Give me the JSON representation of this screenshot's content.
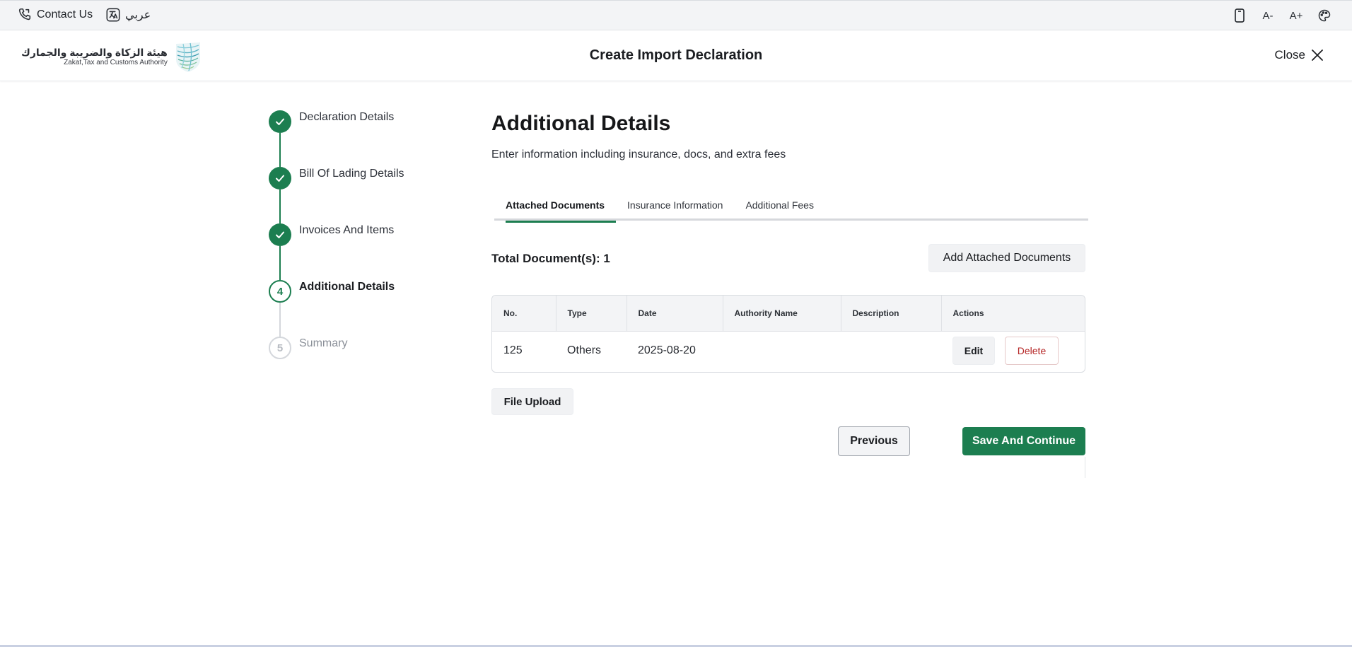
{
  "utility": {
    "contact_us": "Contact Us",
    "language": "عربي",
    "icons": [
      "phone-mobile-icon",
      "font-decrease-icon",
      "font-increase-icon",
      "palette-icon"
    ],
    "font_decrease": "A-",
    "font_increase": "A+"
  },
  "header": {
    "logo_arabic": "هيئة الزكاة والضريبة والجمارك",
    "logo_english": "Zakat,Tax and Customs Authority",
    "title": "Create Import Declaration",
    "close_label": "Close"
  },
  "stepper": {
    "steps": [
      {
        "number": "1",
        "label": "Declaration Details",
        "state": "done"
      },
      {
        "number": "2",
        "label": "Bill Of Lading Details",
        "state": "done"
      },
      {
        "number": "3",
        "label": "Invoices And Items",
        "state": "done"
      },
      {
        "number": "4",
        "label": "Additional Details",
        "state": "active"
      },
      {
        "number": "5",
        "label": "Summary",
        "state": "pending"
      }
    ]
  },
  "main": {
    "title": "Additional Details",
    "subtitle": "Enter information including insurance, docs, and extra fees",
    "tabs": [
      {
        "label": "Attached Documents",
        "active": true
      },
      {
        "label": "Insurance Information",
        "active": false
      },
      {
        "label": "Additional Fees",
        "active": false
      }
    ],
    "total_documents": "Total Document(s): 1",
    "add_documents_label": "Add Attached Documents",
    "table": {
      "headers": [
        "No.",
        "Type",
        "Date",
        "Authority Name",
        "Description",
        "Actions"
      ],
      "rows": [
        {
          "no": "125",
          "type": "Others",
          "date": "2025-08-20",
          "authority": "",
          "description": "",
          "edit_label": "Edit",
          "delete_label": "Delete"
        }
      ]
    },
    "file_upload_label": "File Upload",
    "previous_label": "Previous",
    "save_label": "Save And Continue"
  },
  "colors": {
    "accent": "#1c7e50",
    "danger": "#b42323",
    "utility_bg": "#f3f4f6"
  }
}
